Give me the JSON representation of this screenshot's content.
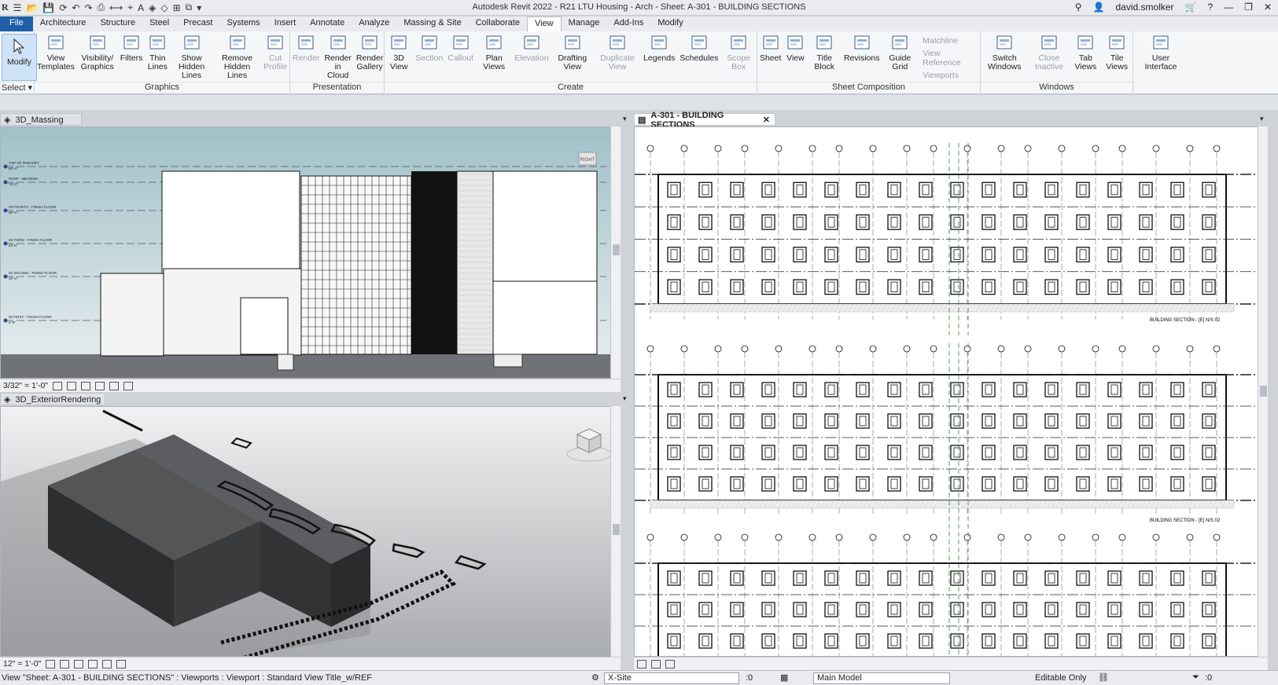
{
  "app": {
    "title": "Autodesk Revit 2022 - R21 LTU Housing - Arch - Sheet: A-301 - BUILDING SECTIONS",
    "logo": "R",
    "user": "david.smolker"
  },
  "menu": [
    "File",
    "Architecture",
    "Structure",
    "Steel",
    "Precast",
    "Systems",
    "Insert",
    "Annotate",
    "Analyze",
    "Massing & Site",
    "Collaborate",
    "View",
    "Manage",
    "Add-Ins",
    "Modify"
  ],
  "active_menu": "View",
  "ribbon": {
    "select": {
      "modify": "Modify",
      "label": "Select"
    },
    "graphics": {
      "title": "Graphics",
      "tools": [
        "View Templates",
        "Visibility/ Graphics",
        "Filters",
        "Thin Lines",
        "Show Hidden Lines",
        "Remove Hidden Lines",
        "Cut Profile"
      ]
    },
    "presentation": {
      "title": "Presentation",
      "tools": [
        "Render",
        "Render in Cloud",
        "Render Gallery"
      ]
    },
    "create": {
      "title": "Create",
      "tools": [
        "3D View",
        "Section",
        "Callout",
        "Plan Views",
        "Elevation",
        "Drafting View",
        "Duplicate View",
        "Legends",
        "Schedules",
        "Scope Box"
      ]
    },
    "sheet": {
      "title": "Sheet Composition",
      "tools": [
        "Sheet",
        "View",
        "Title Block",
        "Revisions",
        "Guide Grid"
      ],
      "small": [
        "Matchline",
        "View Reference",
        "Viewports"
      ]
    },
    "windows": {
      "title": "Windows",
      "tools": [
        "Switch Windows",
        "Close Inactive",
        "Tab Views",
        "Tile Views"
      ]
    },
    "ui": {
      "tools": [
        "User Interface"
      ]
    }
  },
  "views": {
    "v1": {
      "title": "3D_Massing",
      "scale": "3/32\" = 1'-0\"",
      "cube": "RIGHT"
    },
    "v2": {
      "title": "3D_ExteriorRendering",
      "scale": "12\" = 1'-0\""
    },
    "v3": {
      "title": "A-301 - BUILDING SECTIONS",
      "sec1": "BUILDING SECTION - [E] N/S 02",
      "sec2": "BUILDING SECTION - [E] N/S 02"
    }
  },
  "levels": [
    {
      "name": "TOP OF PARAPET",
      "sub": "86'-0\""
    },
    {
      "name": "ROOF - BEARING",
      "sub": "76'-0\""
    },
    {
      "name": "04 FOURTH - FINISH FLOOR",
      "sub": "60'-0\""
    },
    {
      "name": "03 THIRD - FINISH FLOOR",
      "sub": "40'-0\""
    },
    {
      "name": "02 SECOND - FINISH FLOOR",
      "sub": "20'-0\""
    },
    {
      "name": "00 FIRST - FINISH FLOOR",
      "sub": "0'-0\""
    }
  ],
  "status": {
    "message": "View \"Sheet: A-301 - BUILDING SECTIONS\" : Viewports : Viewport : Standard View Title_w/REF",
    "workset": "X-Site",
    "count": ":0",
    "model": "Main Model",
    "editable": "Editable Only",
    "filter": ":0"
  },
  "colors": {
    "accent": "#1f5ea8",
    "sky": "#9fc0c8"
  }
}
